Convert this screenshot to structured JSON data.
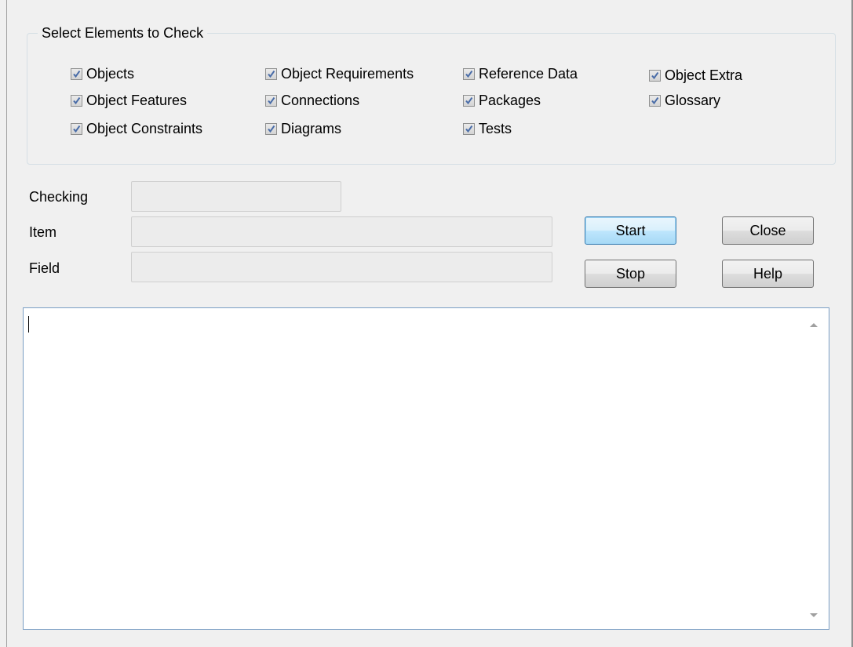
{
  "group": {
    "title": "Select Elements to Check",
    "checkboxes": [
      {
        "label": "Objects",
        "checked": true
      },
      {
        "label": "Object Features",
        "checked": true
      },
      {
        "label": "Object Constraints",
        "checked": true
      },
      {
        "label": "Object Requirements",
        "checked": true
      },
      {
        "label": "Connections",
        "checked": true
      },
      {
        "label": "Diagrams",
        "checked": true
      },
      {
        "label": "Reference Data",
        "checked": true
      },
      {
        "label": "Packages",
        "checked": true
      },
      {
        "label": "Tests",
        "checked": true
      },
      {
        "label": "Object Extra",
        "checked": true
      },
      {
        "label": "Glossary",
        "checked": true
      }
    ]
  },
  "status": {
    "checking_label": "Checking",
    "checking_value": "",
    "item_label": "Item",
    "item_value": "",
    "field_label": "Field",
    "field_value": ""
  },
  "buttons": {
    "start": "Start",
    "stop": "Stop",
    "close": "Close",
    "help": "Help"
  },
  "log": {
    "text": ""
  },
  "colors": {
    "check_mark": "#4a6da8",
    "default_button_border": "#3c7fb1",
    "dialog_background": "#f0f0f0"
  }
}
